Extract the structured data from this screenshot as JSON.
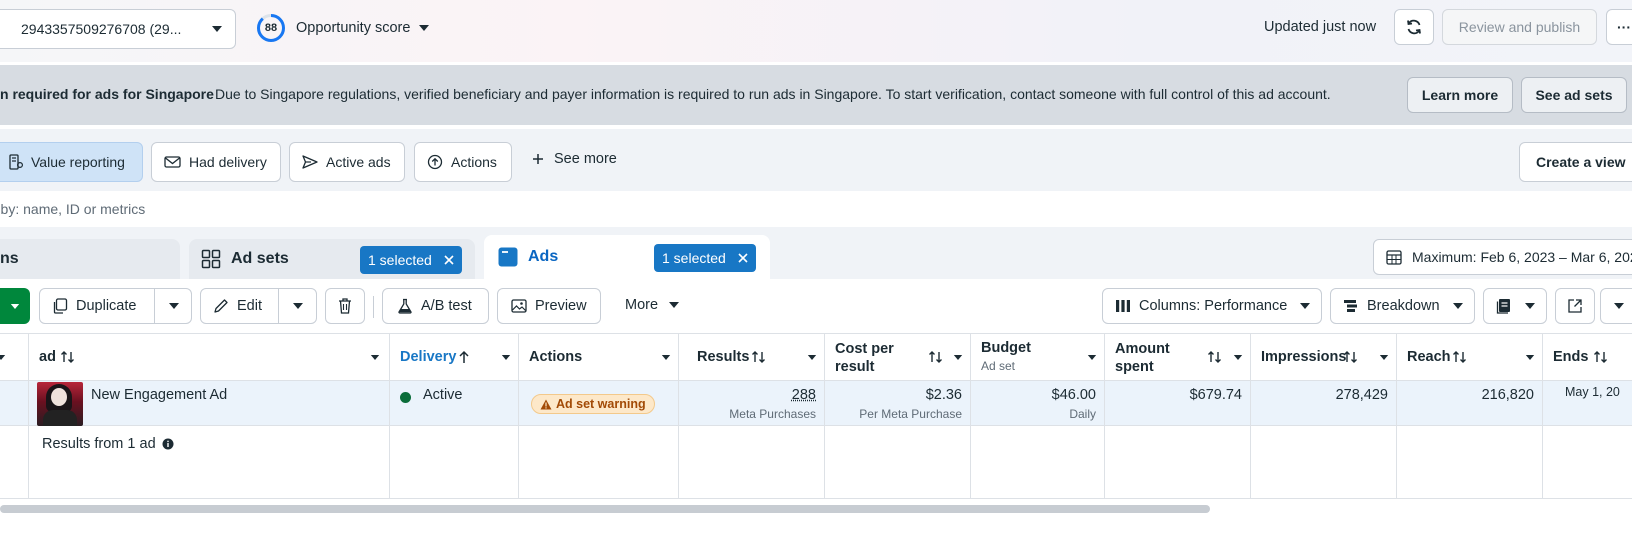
{
  "header": {
    "account_text": "2943357509276708 (29...",
    "opportunity_score": "88",
    "opportunity_label": "Opportunity score",
    "updated_text": "Updated just now",
    "review_publish_label": "Review and publish",
    "more_label": "···"
  },
  "banner": {
    "title": "n required for ads for Singapore",
    "message": "Due to Singapore regulations, verified beneficiary and payer information is required to run ads in Singapore. To start verification, contact someone with full control of this ad account.",
    "learn_more_label": "Learn more",
    "see_ad_sets_label": "See ad sets"
  },
  "views": {
    "items": [
      {
        "label": "Value reporting",
        "icon": "value-reporting-icon",
        "active": true
      },
      {
        "label": "Had delivery",
        "icon": "envelope-icon",
        "active": false
      },
      {
        "label": "Active ads",
        "icon": "send-icon",
        "active": false
      },
      {
        "label": "Actions",
        "icon": "actions-icon",
        "active": false
      }
    ],
    "see_more_label": "See more",
    "create_view_label": "Create a view"
  },
  "search": {
    "placeholder": "r by: name, ID or metrics"
  },
  "tabs": {
    "campaigns_label": "ns",
    "adsets_label": "Ad sets",
    "adsets_selected": "1 selected",
    "ads_label": "Ads",
    "ads_selected": "1 selected",
    "date_range": "Maximum: Feb 6, 2023 – Mar 6, 2023"
  },
  "toolbar": {
    "duplicate_label": "Duplicate",
    "edit_label": "Edit",
    "ab_test_label": "A/B test",
    "preview_label": "Preview",
    "more_label": "More",
    "columns_label": "Columns: Performance",
    "breakdown_label": "Breakdown"
  },
  "table": {
    "headers": {
      "ad": "ad",
      "delivery": "Delivery",
      "actions": "Actions",
      "results": "Results",
      "cost_per_result": "Cost per result",
      "budget": "Budget",
      "budget_sub": "Ad set",
      "amount_spent": "Amount spent",
      "impressions": "Impressions",
      "reach": "Reach",
      "ends": "Ends"
    },
    "rows": [
      {
        "name": "New Engagement Ad",
        "delivery": "Active",
        "actions": "Ad set warning",
        "results": "288",
        "results_sub": "Meta Purchases",
        "cost_per_result": "$2.36",
        "cost_sub": "Per Meta Purchase",
        "budget": "$46.00",
        "budget_sub": "Daily",
        "amount_spent": "$679.74",
        "impressions": "278,429",
        "reach": "216,820",
        "ends": "May 1, 20"
      }
    ],
    "summary_text": "Results from 1 ad"
  },
  "colors": {
    "accent": "#1877c5",
    "create_green": "#00873c",
    "active_status": "#0b6d3a",
    "warning": "#a24a06"
  }
}
